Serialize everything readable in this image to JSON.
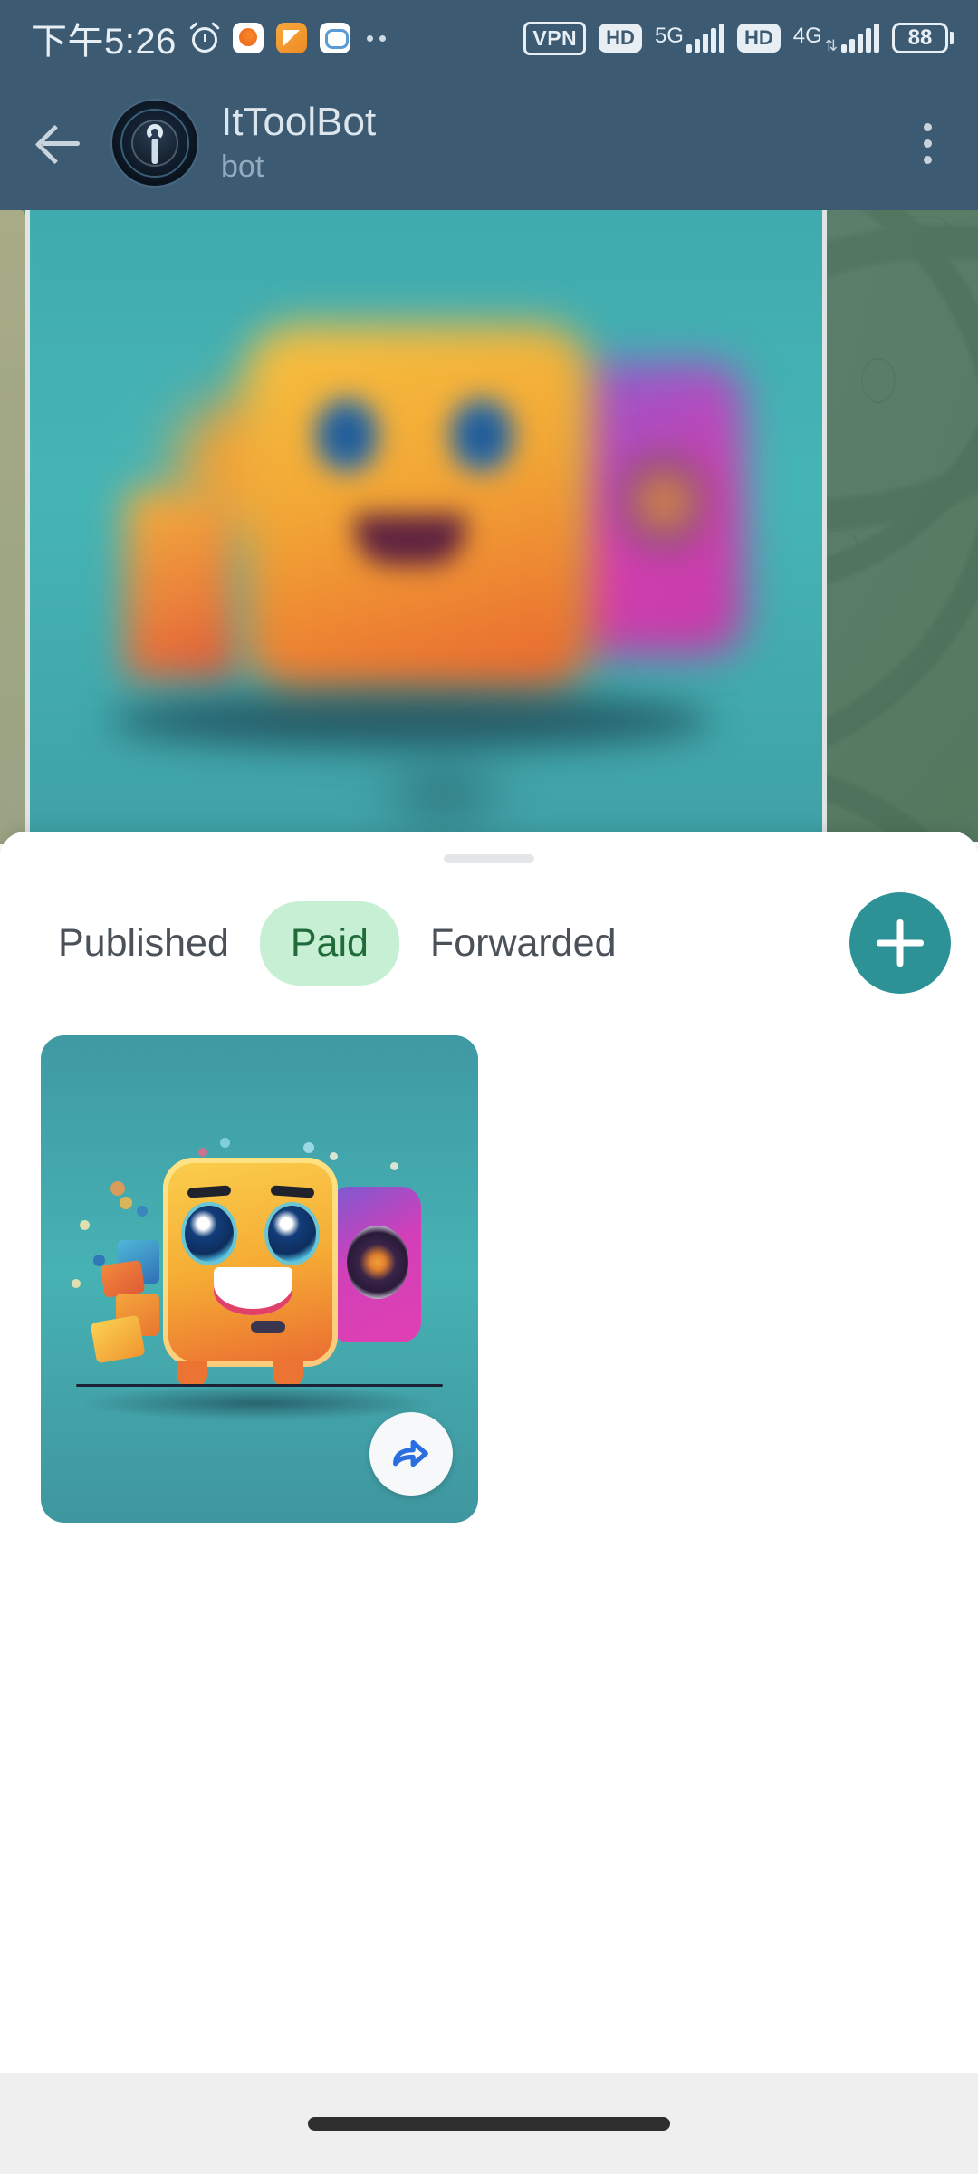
{
  "status_bar": {
    "time": "下午5:26",
    "alarm_icon": "alarm-clock-icon",
    "app_icons": [
      "phone-app-icon",
      "note-app-icon",
      "chat-app-icon"
    ],
    "overflow_dots": "status-overflow-dots",
    "vpn_label": "VPN",
    "sim1": {
      "hd_label": "HD",
      "network": "5G",
      "signal_bars": 5
    },
    "sim2": {
      "hd_label": "HD",
      "network": "4G",
      "signal_bars": 5
    },
    "battery_level": "88",
    "background_color": "#3d5a73"
  },
  "app_bar": {
    "back_icon": "back-arrow-icon",
    "avatar_icon": "bot-avatar-icon",
    "title": "ItToolBot",
    "subtitle": "bot",
    "menu_icon": "overflow-menu-icon",
    "background_color": "#3d5a73",
    "title_color": "#dde6ec",
    "subtitle_color": "#93abbe"
  },
  "sheet": {
    "handle_name": "drag-handle",
    "background_color": "#ffffff"
  },
  "tabs": [
    {
      "label": "Published",
      "active": false
    },
    {
      "label": "Paid",
      "active": true
    },
    {
      "label": "Forwarded",
      "active": false
    }
  ],
  "tab_colors": {
    "active_bg": "#c7efd4",
    "active_text": "#1f6b39",
    "inactive_text": "#4a5158"
  },
  "add_button": {
    "icon": "plus-icon",
    "color": "#2d9296"
  },
  "media_items": [
    {
      "name": "robot-camera-thumbnail",
      "share_icon": "share-forward-icon",
      "share_icon_color": "#2a6ee0",
      "background_color": "#46b2b4"
    }
  ],
  "nav_bar": {
    "gesture_pill": "home-gesture-pill",
    "background_color": "#efefef"
  }
}
